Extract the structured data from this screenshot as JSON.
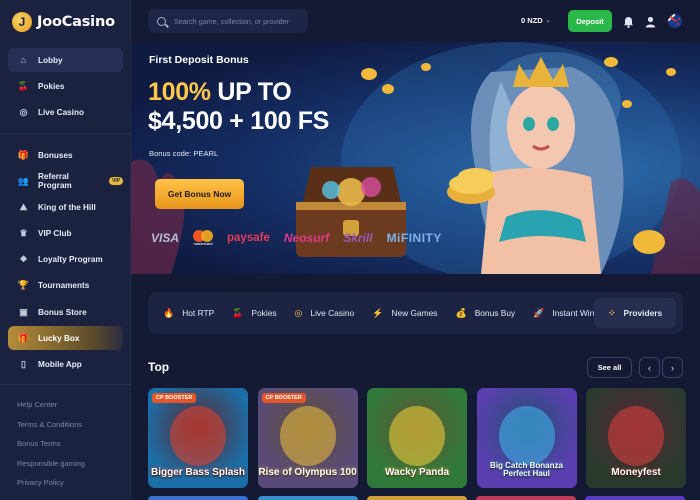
{
  "brand": {
    "name": "JooCasino",
    "mark": "J"
  },
  "sidebar": {
    "items": [
      {
        "label": "Lobby",
        "icon": "home-icon",
        "glyph": "⌂",
        "active": true
      },
      {
        "label": "Pokies",
        "icon": "cherries-icon",
        "glyph": "🍒"
      },
      {
        "label": "Live Casino",
        "icon": "roulette-icon",
        "glyph": "◎"
      }
    ],
    "items2": [
      {
        "label": "Bonuses",
        "icon": "gift-icon",
        "glyph": "🎁"
      },
      {
        "label": "Referral Program",
        "icon": "users-icon",
        "glyph": "👥",
        "badge": "VIP"
      },
      {
        "label": "King of the Hill",
        "icon": "mountain-icon",
        "glyph": "⛰"
      },
      {
        "label": "VIP Club",
        "icon": "crown-icon",
        "glyph": "♛"
      },
      {
        "label": "Loyalty Program",
        "icon": "trophy-star-icon",
        "glyph": "❖"
      },
      {
        "label": "Tournaments",
        "icon": "trophy-icon",
        "glyph": "🏆"
      },
      {
        "label": "Bonus Store",
        "icon": "store-icon",
        "glyph": "▣"
      },
      {
        "label": "Lucky Box",
        "icon": "lucky-box-icon",
        "glyph": "🎁",
        "highlight": true
      },
      {
        "label": "Mobile App",
        "icon": "mobile-icon",
        "glyph": "▯"
      }
    ],
    "footer": [
      "Help Center",
      "Terms & Conditions",
      "Bonus Terms",
      "Responsible gaming",
      "Privacy Policy"
    ]
  },
  "header": {
    "search_placeholder": "Search game, collection, or provider",
    "balance": "0 NZD",
    "deposit_label": "Deposit"
  },
  "banner": {
    "title": "First Deposit Bonus",
    "headline_gold": "100%",
    "headline_rest": " UP TO",
    "headline_line2": "$4,500 + 100 FS",
    "bonus_code": "Bonus code: PEARL",
    "cta_label": "Get Bonus Now",
    "payments": [
      "VISA",
      "mastercard",
      "paysafe",
      "Neosurf",
      "Skrill",
      "MiFINITY"
    ]
  },
  "tabs": [
    {
      "label": "Hot RTP",
      "icon": "fire-icon",
      "glyph": "🔥"
    },
    {
      "label": "Pokies",
      "icon": "cherries-icon",
      "glyph": "🍒"
    },
    {
      "label": "Live Casino",
      "icon": "roulette-icon",
      "glyph": "◎"
    },
    {
      "label": "New Games",
      "icon": "lightning-icon",
      "glyph": "⚡"
    },
    {
      "label": "Bonus Buy",
      "icon": "bag-icon",
      "glyph": "💰"
    },
    {
      "label": "Instant Win",
      "icon": "rocket-icon",
      "glyph": "🚀"
    }
  ],
  "providers_tab": {
    "label": "Providers",
    "icon": "grid-icon",
    "glyph": "⁘"
  },
  "top_section": {
    "title": "Top",
    "see_all": "See all",
    "prev": "‹",
    "next": "›",
    "games": [
      {
        "name": "Bigger Bass Splash",
        "badge": "CP BOOSTER",
        "bg": "#1b6fa8",
        "accent": "#e8412c"
      },
      {
        "name": "Rise of Olympus 100",
        "badge": "CP BOOSTER",
        "bg": "#5a4a7a",
        "accent": "#f0c040"
      },
      {
        "name": "Wacky Panda",
        "badge": "",
        "bg": "#2f7a3a",
        "accent": "#f7d23a"
      },
      {
        "name": "Big Catch Bonanza Perfect Haul",
        "badge": "",
        "bg": "#5b3fb0",
        "accent": "#3fb8f0"
      },
      {
        "name": "Moneyfest",
        "badge": "",
        "bg": "#2a3a2e",
        "accent": "#e0403a"
      }
    ]
  }
}
